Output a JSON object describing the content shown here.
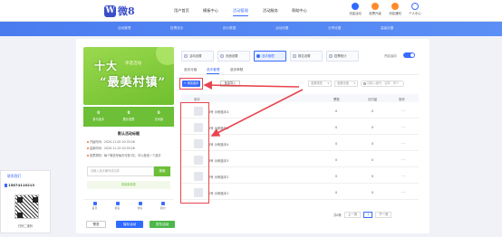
{
  "brand": {
    "mark": "W",
    "name": "微8"
  },
  "nav": [
    {
      "label": "用户首页",
      "active": false
    },
    {
      "label": "模板中心",
      "active": false
    },
    {
      "label": "活动管理",
      "active": true
    },
    {
      "label": "活动服务",
      "active": false
    },
    {
      "label": "帮助中心",
      "active": false
    }
  ],
  "tools": [
    {
      "label": "流量活动",
      "color": "#2f6bff"
    },
    {
      "label": "投票升级",
      "color": "#ff8a2b"
    },
    {
      "label": "消息通知",
      "color": "#ff8a2b"
    },
    {
      "label": "个人中心",
      "color": "#3a6bff"
    }
  ],
  "banner": [
    "活动管理",
    "投票选手",
    "统计数据",
    "活动设置",
    "分享设置",
    "高级设置"
  ],
  "preview": {
    "hero_title": "十大",
    "hero_sub": "评选活动",
    "hero_big": "“最美村镇”",
    "stats": [
      {
        "num": "0",
        "label": "参与选手"
      },
      {
        "num": "0",
        "label": "累计投票"
      },
      {
        "num": "0",
        "label": "访问量"
      }
    ],
    "info_title": "默认活动标题",
    "info_lines": [
      "开始时间：2020-11-05 10:33:26",
      "结束时间：2020-11-15 10:33:26",
      "投票规则：每个微信号每天可投3次，可以投给一个选手"
    ],
    "search_placeholder": "请输入选手编号或名称",
    "search_button": "搜索",
    "sort_label": "按最新参赛",
    "bottom_nav": [
      "首页",
      "报名",
      "排名",
      "我的"
    ]
  },
  "actions": {
    "share": "预览",
    "save": "保存活动",
    "publish": "发布活动"
  },
  "service": {
    "title": "联系我们",
    "phone": "15874110213",
    "qr_caption": "扫码二维码"
  },
  "steps": [
    {
      "label": "活动设置",
      "active": false
    },
    {
      "label": "页面设置",
      "active": false
    },
    {
      "label": "选手管理",
      "active": true
    },
    {
      "label": "报名设置",
      "active": false
    },
    {
      "label": "投票统计",
      "active": false
    }
  ],
  "toggle_label": "开启活动",
  "subtabs": [
    {
      "label": "选手分组",
      "active": false
    },
    {
      "label": "选手管理",
      "active": true
    },
    {
      "label": "选手审核",
      "active": false
    }
  ],
  "toolbar": {
    "add": "+ 添加选手",
    "batch": "批量导入",
    "filter1": "全部状态",
    "filter2": "全部分组",
    "search_placeholder": "请输入编号、名称、简介"
  },
  "table": {
    "headers": [
      "选手",
      "票数",
      "访问量",
      "操作"
    ],
    "rows": [
      {
        "name": "4号  示例选手4",
        "votes": "0",
        "views": "0",
        "action": "⋯"
      },
      {
        "name": "5号  示例选手5",
        "votes": "0",
        "views": "0",
        "action": "⋯"
      },
      {
        "name": "4号  示例选手4",
        "votes": "0",
        "views": "0",
        "action": "⋯"
      },
      {
        "name": "3号  示例选手3",
        "votes": "0",
        "views": "0",
        "action": "⋯"
      },
      {
        "name": "2号  示例选手2",
        "votes": "0",
        "views": "0",
        "action": "⋯"
      },
      {
        "name": "1号  示例选手1",
        "votes": "0",
        "views": "0",
        "action": "⋯"
      }
    ]
  },
  "pager": {
    "total": "共6条",
    "prev": "上一页",
    "current": "1",
    "next": "下一页"
  }
}
